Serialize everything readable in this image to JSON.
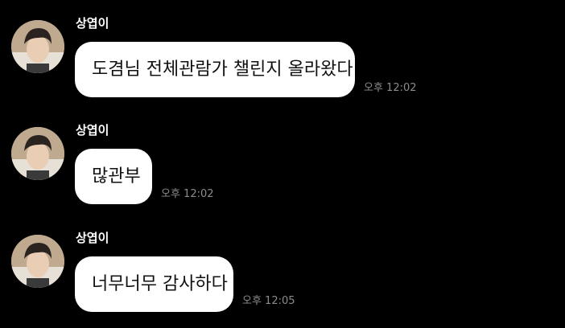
{
  "colors": {
    "background": "#000000",
    "bubble": "#ffffff",
    "bubble_text": "#111111",
    "sender_text": "#ffffff",
    "time_text": "#8c8c8c"
  },
  "messages": [
    {
      "sender": "상엽이",
      "text": "도겸님 전체관람가 챌린지 올라왔다",
      "time": "오후 12:02",
      "avatar_icon": "profile-photo"
    },
    {
      "sender": "상엽이",
      "text": "많관부",
      "time": "오후 12:02",
      "avatar_icon": "profile-photo"
    },
    {
      "sender": "상엽이",
      "text": "너무너무 감사하다",
      "time": "오후 12:05",
      "avatar_icon": "profile-photo"
    }
  ]
}
